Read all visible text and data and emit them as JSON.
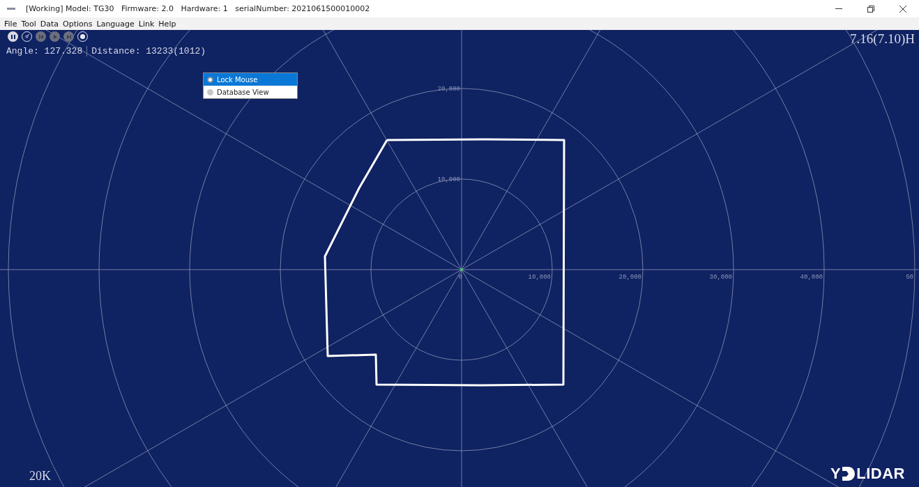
{
  "window": {
    "title": "[Working] Model: TG30   Firmware: 2.0   Hardware: 1   serialNumber: 2021061500010002"
  },
  "menu": [
    "File",
    "Tool",
    "Data",
    "Options",
    "Language",
    "Link",
    "Help"
  ],
  "toolbar": [
    {
      "kind": "pause",
      "disabled": false
    },
    {
      "kind": "gauge",
      "disabled": false
    },
    {
      "kind": "previous",
      "disabled": true
    },
    {
      "kind": "play",
      "disabled": true
    },
    {
      "kind": "next",
      "disabled": true
    },
    {
      "kind": "record",
      "disabled": false
    }
  ],
  "readout": {
    "angle": "Angle: 127.328",
    "distance": "Distance: 13233(1012)"
  },
  "frequency": "7.16(7.10)H",
  "popup_menu": [
    {
      "label": "Lock Mouse",
      "selected": true
    },
    {
      "label": "Database View",
      "selected": false
    }
  ],
  "plot": {
    "x_labels": [
      "0",
      "10,000",
      "20,000",
      "30,000",
      "40,000",
      "50"
    ],
    "y_labels": [
      "20,000",
      "10,000"
    ]
  },
  "range": "20K",
  "logo": {
    "left": "Y",
    "right": "LIDAR"
  }
}
